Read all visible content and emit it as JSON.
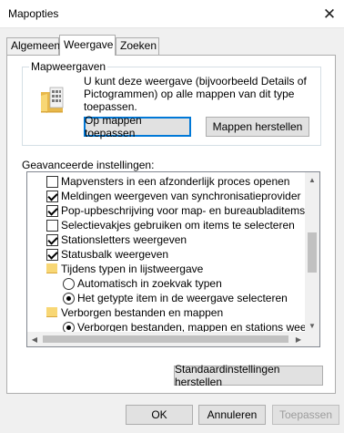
{
  "window": {
    "title": "Mapopties",
    "close_glyph": "✕"
  },
  "tabs": [
    {
      "label": "Algemeen",
      "active": false
    },
    {
      "label": "Weergave",
      "active": true
    },
    {
      "label": "Zoeken",
      "active": false
    }
  ],
  "folder_views": {
    "legend": "Mapweergaven",
    "description": "U kunt deze weergave (bijvoorbeeld Details of Pictogrammen) op alle mappen van dit type toepassen.",
    "apply_label": "Op mappen toepassen",
    "reset_label": "Mappen herstellen",
    "icon": "folder-icon"
  },
  "advanced": {
    "label": "Geavanceerde instellingen:",
    "items": [
      {
        "type": "checkbox",
        "checked": false,
        "indent": 1,
        "label": "Mapvensters in een afzonderlijk proces openen"
      },
      {
        "type": "checkbox",
        "checked": true,
        "indent": 1,
        "label": "Meldingen weergeven van synchronisatieprovider"
      },
      {
        "type": "checkbox",
        "checked": true,
        "indent": 1,
        "label": "Pop-upbeschrijving voor map- en bureaubladitems weergeven"
      },
      {
        "type": "checkbox",
        "checked": false,
        "indent": 1,
        "label": "Selectievakjes gebruiken om items te selecteren"
      },
      {
        "type": "checkbox",
        "checked": true,
        "indent": 1,
        "label": "Stationsletters weergeven"
      },
      {
        "type": "checkbox",
        "checked": true,
        "indent": 1,
        "label": "Statusbalk weergeven"
      },
      {
        "type": "folder",
        "indent": 1,
        "label": "Tijdens typen in lijstweergave"
      },
      {
        "type": "radio",
        "checked": false,
        "indent": 2,
        "label": "Automatisch in zoekvak typen"
      },
      {
        "type": "radio",
        "checked": true,
        "indent": 2,
        "label": "Het getypte item in de weergave selecteren"
      },
      {
        "type": "folder",
        "indent": 1,
        "label": "Verborgen bestanden en mappen"
      },
      {
        "type": "radio",
        "checked": true,
        "indent": 2,
        "label": "Verborgen bestanden, mappen en stations weergeven"
      }
    ]
  },
  "restore_defaults_label": "Standaardinstellingen herstellen",
  "buttons": {
    "ok": "OK",
    "cancel": "Annuleren",
    "apply": "Toepassen"
  },
  "colors": {
    "focus": "#0078d7",
    "folder": "#f8d775"
  }
}
